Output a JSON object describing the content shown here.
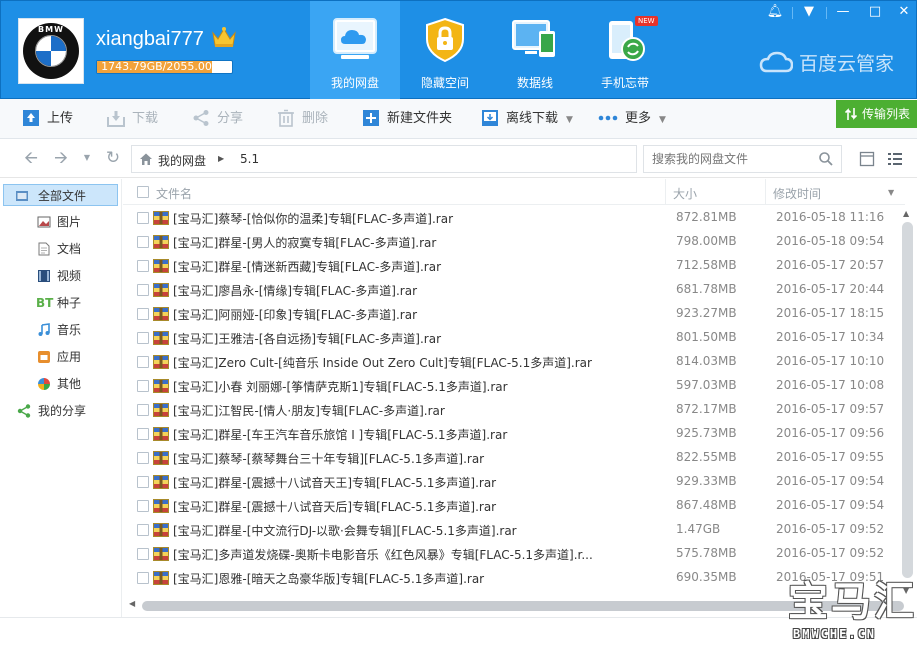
{
  "header": {
    "username": "xiangbai777",
    "quota_text": "1743.79GB/2055.00GB",
    "quota_fraction": 0.8486,
    "tabs": [
      {
        "label": "我的网盘",
        "icon": "cloud-drive-icon",
        "active": true
      },
      {
        "label": "隐藏空间",
        "icon": "lock-icon",
        "active": false
      },
      {
        "label": "数据线",
        "icon": "devices-icon",
        "active": false
      },
      {
        "label": "手机忘带",
        "icon": "phone-sync-icon",
        "active": false,
        "badge": "NEW"
      }
    ],
    "brand": "百度云管家",
    "accent_color": "#1e8fe6"
  },
  "toolbar": {
    "upload": "上传",
    "download": "下载",
    "share": "分享",
    "delete": "删除",
    "new_folder": "新建文件夹",
    "offline_download": "离线下载",
    "more": "更多",
    "transfer_list": "传输列表"
  },
  "address": {
    "crumb_root": "我的网盘",
    "crumb_current": "5.1",
    "search_placeholder": "搜索我的网盘文件"
  },
  "sidebar": {
    "items": [
      {
        "label": "全部文件",
        "icon": "all-files-icon",
        "active": true
      },
      {
        "label": "图片",
        "icon": "picture-icon"
      },
      {
        "label": "文档",
        "icon": "document-icon"
      },
      {
        "label": "视频",
        "icon": "video-icon"
      },
      {
        "label": "种子",
        "icon": "torrent-icon"
      },
      {
        "label": "音乐",
        "icon": "music-icon"
      },
      {
        "label": "应用",
        "icon": "app-icon"
      },
      {
        "label": "其他",
        "icon": "other-icon"
      },
      {
        "label": "我的分享",
        "icon": "share-icon"
      }
    ]
  },
  "list": {
    "columns": {
      "name": "文件名",
      "size": "大小",
      "date": "修改时间"
    },
    "rows": [
      {
        "name": "[宝马汇]蔡琴-[恰似你的温柔]专辑[FLAC-多声道].rar",
        "size": "872.81MB",
        "date": "2016-05-18 11:16"
      },
      {
        "name": "[宝马汇]群星-[男人的寂寞专辑[FLAC-多声道].rar",
        "size": "798.00MB",
        "date": "2016-05-18 09:54"
      },
      {
        "name": "[宝马汇]群星-[情迷新西藏]专辑[FLAC-多声道].rar",
        "size": "712.58MB",
        "date": "2016-05-17 20:57"
      },
      {
        "name": "[宝马汇]廖昌永-[情缘]专辑[FLAC-多声道].rar",
        "size": "681.78MB",
        "date": "2016-05-17 20:44"
      },
      {
        "name": "[宝马汇]阿丽娅-[印象]专辑[FLAC-多声道].rar",
        "size": "923.27MB",
        "date": "2016-05-17 18:15"
      },
      {
        "name": "[宝马汇]王雅洁-[各自远扬]专辑[FLAC-多声道].rar",
        "size": "801.50MB",
        "date": "2016-05-17 10:34"
      },
      {
        "name": "[宝马汇]Zero Cult-[纯音乐 Inside Out Zero Cult]专辑[FLAC-5.1多声道].rar",
        "size": "814.03MB",
        "date": "2016-05-17 10:10"
      },
      {
        "name": "[宝马汇]小春 刘丽娜-[筝情萨克斯1]专辑[FLAC-5.1多声道].rar",
        "size": "597.03MB",
        "date": "2016-05-17 10:08"
      },
      {
        "name": "[宝马汇]江智民-[情人·朋友]专辑[FLAC-多声道].rar",
        "size": "872.17MB",
        "date": "2016-05-17 09:57"
      },
      {
        "name": "[宝马汇]群星-[车王汽车音乐旅馆 I ]专辑[FLAC-5.1多声道].rar",
        "size": "925.73MB",
        "date": "2016-05-17 09:56"
      },
      {
        "name": "[宝马汇]蔡琴-[蔡琴舞台三十年专辑][FLAC-5.1多声道].rar",
        "size": "822.55MB",
        "date": "2016-05-17 09:55"
      },
      {
        "name": "[宝马汇]群星-[震撼十八试音天王]专辑[FLAC-5.1多声道].rar",
        "size": "929.33MB",
        "date": "2016-05-17 09:54"
      },
      {
        "name": "[宝马汇]群星-[震撼十八试音天后]专辑[FLAC-5.1多声道].rar",
        "size": "867.48MB",
        "date": "2016-05-17 09:54"
      },
      {
        "name": "[宝马汇]群星-[中文流行DJ-以歌·会舞专辑][FLAC-5.1多声道].rar",
        "size": "1.47GB",
        "date": "2016-05-17 09:52"
      },
      {
        "name": "[宝马汇]多声道发烧碟-奥斯卡电影音乐《红色风暴》专辑[FLAC-5.1多声道].r...",
        "size": "575.78MB",
        "date": "2016-05-17 09:52"
      },
      {
        "name": "[宝马汇]恩雅-[暗天之岛豪华版]专辑[FLAC-5.1多声道].rar",
        "size": "690.35MB",
        "date": "2016-05-17 09:51"
      }
    ]
  },
  "watermark": {
    "big": "宝马汇",
    "small": "BMWCHE.CN"
  }
}
